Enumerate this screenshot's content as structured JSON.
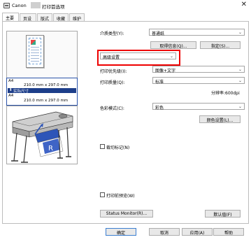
{
  "window": {
    "title_prefix": "Canon",
    "title_suffix": "打印首选项",
    "close_glyph": "✕"
  },
  "tabs": [
    {
      "label": "主要",
      "active": true
    },
    {
      "label": "页设置",
      "active": false
    },
    {
      "label": "版式",
      "active": false
    },
    {
      "label": "收藏",
      "active": false
    },
    {
      "label": "维护",
      "active": false
    }
  ],
  "preview": {
    "paper_size_a": "A4",
    "paper_dims_a": "210.0 mm x 297.0 mm",
    "actual_size": "实际尺寸",
    "paper_size_b": "A4",
    "paper_dims_b": "210.0 mm x 297.0 mm"
  },
  "media": {
    "label": "介质类型(Y):",
    "value": "普通纸",
    "get_info_btn": "取得信息(Q)...",
    "specify_btn": "指定(S)..."
  },
  "settings_mode": {
    "value": "高级设置"
  },
  "print_priority": {
    "label": "打印优先级(I):",
    "value": "图像+文字"
  },
  "print_quality": {
    "label": "打印质量(Q):",
    "value": "标准",
    "resolution": "分辨率:600dpi"
  },
  "color_mode": {
    "label": "色彩模式(C):",
    "value": "彩色",
    "color_settings_btn": "颜色设置(L)..."
  },
  "crop_marks": {
    "label": "裁切标记(N)"
  },
  "preview_before_print": {
    "label": "打印前预览(W)"
  },
  "status_monitor_btn": "Status Monitor(R)...",
  "defaults_btn": "默认值(F)",
  "footer": {
    "ok": "确定",
    "cancel": "取消",
    "apply": "应用(A)",
    "help": "帮助"
  },
  "colors": {
    "selection": "#1d3e8a",
    "highlight": "#ee0000",
    "default_button_border": "#3c7fd1"
  }
}
